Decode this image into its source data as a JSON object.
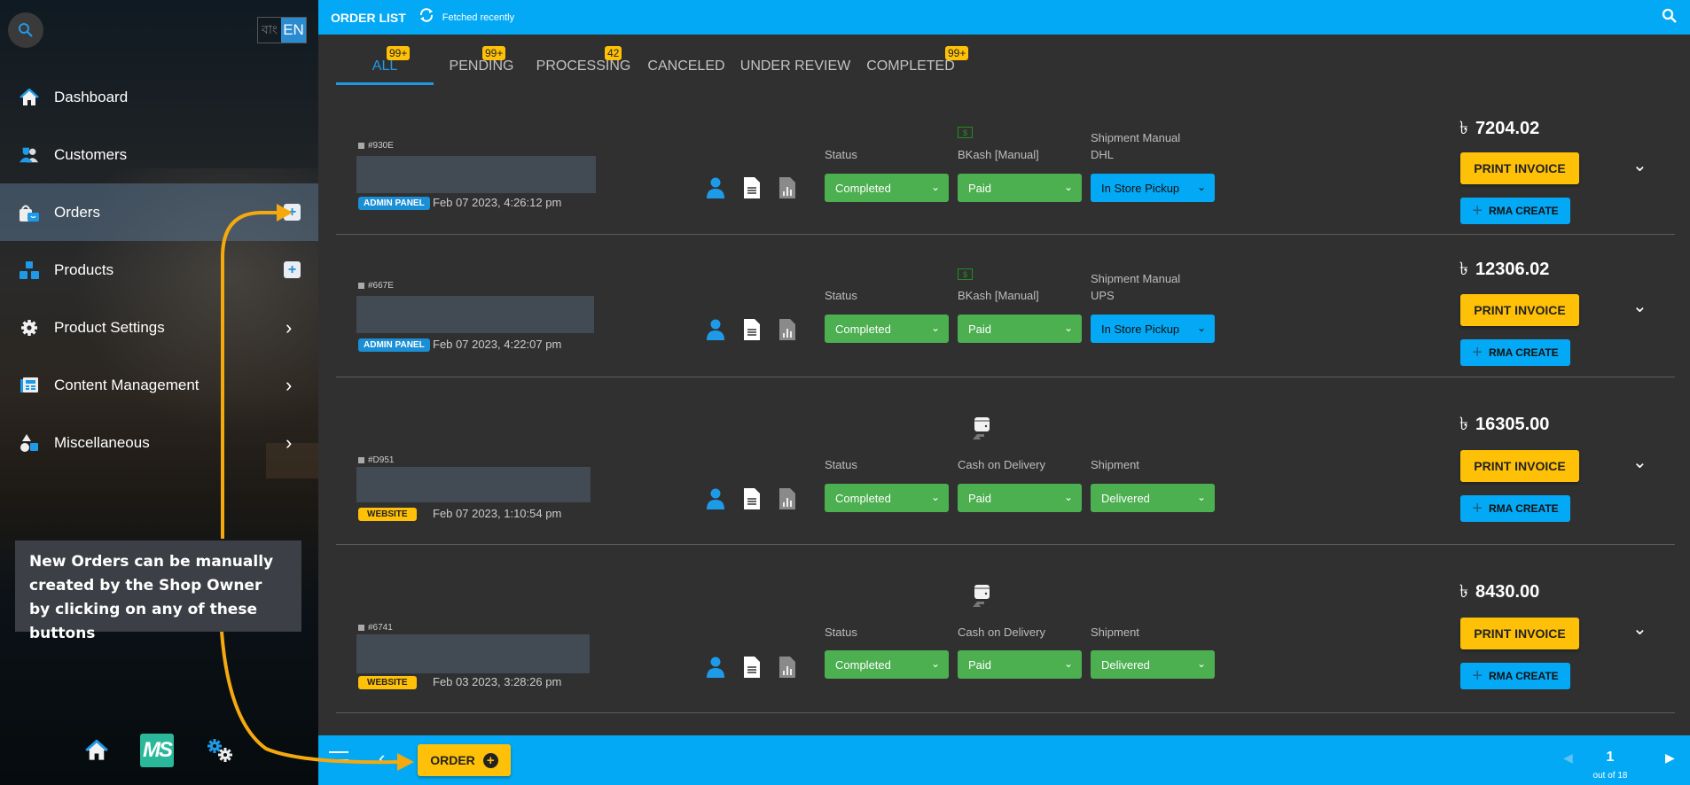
{
  "sidebar": {
    "search_icon": "search-icon",
    "language": {
      "bn": "বাং",
      "en": "EN",
      "active": "EN"
    },
    "items": [
      {
        "label": "Dashboard",
        "icon": "home-icon",
        "action": "none"
      },
      {
        "label": "Customers",
        "icon": "customers-icon",
        "action": "none"
      },
      {
        "label": "Orders",
        "icon": "orders-bag-icon",
        "action": "add",
        "active": true
      },
      {
        "label": "Products",
        "icon": "products-boxes-icon",
        "action": "add"
      },
      {
        "label": "Product Settings",
        "icon": "gear-icon",
        "action": "expand"
      },
      {
        "label": "Content Management",
        "icon": "newspaper-icon",
        "action": "expand"
      },
      {
        "label": "Miscellaneous",
        "icon": "shapes-icon",
        "action": "expand"
      }
    ],
    "bottom": {
      "logo_text": "MS",
      "home_icon": "home-icon",
      "settings_icon": "gears-icon"
    }
  },
  "topbar": {
    "title": "ORDER LIST",
    "status": "Fetched recently",
    "accent": "#03a9f4"
  },
  "tabs": [
    {
      "label": "ALL",
      "badge": "99+",
      "active": true
    },
    {
      "label": "PENDING",
      "badge": "99+"
    },
    {
      "label": "PROCESSING",
      "badge": "42"
    },
    {
      "label": "CANCELED",
      "badge": ""
    },
    {
      "label": "UNDER REVIEW",
      "badge": ""
    },
    {
      "label": "COMPLETED",
      "badge": "99+"
    }
  ],
  "orders": [
    {
      "id": "#930E",
      "source": "ADMIN PANEL",
      "date": "Feb 07 2023, 4:26:12 pm",
      "status_label": "Status",
      "status": "Completed",
      "payment_label": "BKash [Manual]",
      "payment": "Paid",
      "payment_icon": "cash-icon",
      "shipment_label_1": "Shipment Manual",
      "shipment_label_2": "DHL",
      "shipment": "In Store Pickup",
      "price": "7204.02"
    },
    {
      "id": "#667E",
      "source": "ADMIN PANEL",
      "date": "Feb 07 2023, 4:22:07 pm",
      "status_label": "Status",
      "status": "Completed",
      "payment_label": "BKash [Manual]",
      "payment": "Paid",
      "payment_icon": "cash-icon",
      "shipment_label_1": "Shipment Manual",
      "shipment_label_2": "UPS",
      "shipment": "In Store Pickup",
      "price": "12306.02"
    },
    {
      "id": "#D951",
      "source": "WEBSITE",
      "date": "Feb 07 2023, 1:10:54 pm",
      "status_label": "Status",
      "status": "Completed",
      "payment_label": "Cash on Delivery",
      "payment": "Paid",
      "payment_icon": "wallet-hand-icon",
      "shipment_label_1": "Shipment",
      "shipment_label_2": "",
      "shipment": "Delivered",
      "price": "16305.00"
    },
    {
      "id": "#6741",
      "source": "WEBSITE",
      "date": "Feb 03 2023, 3:28:26 pm",
      "status_label": "Status",
      "status": "Completed",
      "payment_label": "Cash on Delivery",
      "payment": "Paid",
      "payment_icon": "wallet-hand-icon",
      "shipment_label_1": "Shipment",
      "shipment_label_2": "",
      "shipment": "Delivered",
      "price": "8430.00"
    }
  ],
  "currency_symbol": "৳",
  "buttons": {
    "print_invoice": "PRINT INVOICE",
    "rma_create": "RMA CREATE",
    "order": "ORDER"
  },
  "pagination": {
    "page": "1",
    "total_text": "out of 18"
  },
  "annotation": {
    "text": "New Orders can be manually created by the Shop Owner by clicking on any of these buttons",
    "arrow_color": "#f5a90e"
  }
}
